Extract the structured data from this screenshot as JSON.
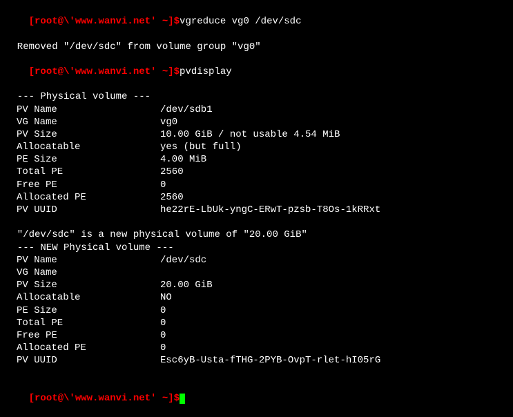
{
  "prompt1": {
    "user_host": "[root@\\'www.wanvi.net' ~]$",
    "command": "vgreduce vg0 /dev/sdc"
  },
  "output1": "  Removed \"/dev/sdc\" from volume group \"vg0\"",
  "prompt2": {
    "user_host": "[root@\\'www.wanvi.net' ~]$",
    "command": "pvdisplay"
  },
  "pv1": {
    "header": "  --- Physical volume ---",
    "fields": {
      "pv_name_label": "PV Name",
      "pv_name_value": "/dev/sdb1",
      "vg_name_label": "VG Name",
      "vg_name_value": "vg0",
      "pv_size_label": "PV Size",
      "pv_size_value": "10.00 GiB / not usable 4.54 MiB",
      "allocatable_label": "Allocatable",
      "allocatable_value": "yes (but full)",
      "pe_size_label": "PE Size",
      "pe_size_value": "4.00 MiB",
      "total_pe_label": "Total PE",
      "total_pe_value": "2560",
      "free_pe_label": "Free PE",
      "free_pe_value": "0",
      "allocated_pe_label": "Allocated PE",
      "allocated_pe_value": "2560",
      "pv_uuid_label": "PV UUID",
      "pv_uuid_value": "he22rE-LbUk-yngC-ERwT-pzsb-T8Os-1kRRxt"
    }
  },
  "blank": " ",
  "new_pv_notice": "  \"/dev/sdc\" is a new physical volume of \"20.00 GiB\"",
  "pv2": {
    "header": "  --- NEW Physical volume ---",
    "fields": {
      "pv_name_label": "PV Name",
      "pv_name_value": "/dev/sdc",
      "vg_name_label": "VG Name",
      "vg_name_value": "",
      "pv_size_label": "PV Size",
      "pv_size_value": "20.00 GiB",
      "allocatable_label": "Allocatable",
      "allocatable_value": "NO",
      "pe_size_label": "PE Size",
      "pe_size_value": "0",
      "total_pe_label": "Total PE",
      "total_pe_value": "0",
      "free_pe_label": "Free PE",
      "free_pe_value": "0",
      "allocated_pe_label": "Allocated PE",
      "allocated_pe_value": "0",
      "pv_uuid_label": "PV UUID",
      "pv_uuid_value": "Esc6yB-Usta-fTHG-2PYB-OvpT-rlet-hI05rG"
    }
  },
  "prompt3": {
    "user_host": "[root@\\'www.wanvi.net' ~]$"
  }
}
